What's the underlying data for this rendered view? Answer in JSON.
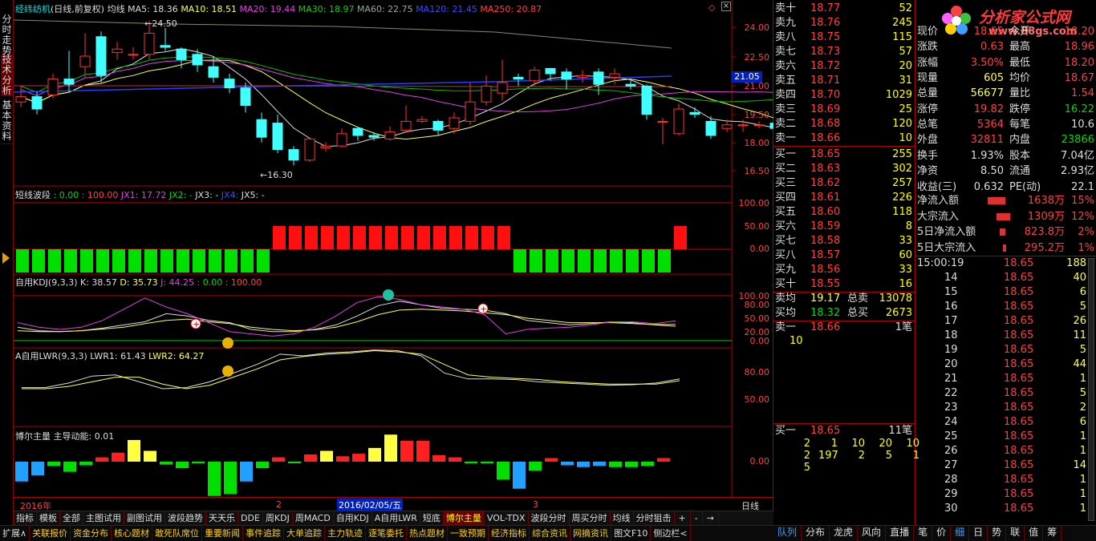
{
  "side_tabs": [
    "分时走势",
    "技术分析",
    "基本资料"
  ],
  "title": {
    "name": "经纬纺机",
    "mode": "(日线,前复权)",
    "ma_label": "均线",
    "ma5": "MA5: 18.36",
    "ma10": "MA10: 18.51",
    "ma20": "MA20: 19.44",
    "ma30": "MA30: 18.97",
    "ma60": "MA60: 22.75",
    "ma120": "MA120: 21.45",
    "ma250": "MA250: 20.87"
  },
  "price_axis": [
    "24.00",
    "22.50",
    "21.00",
    "19.50",
    "18.00",
    "16.50"
  ],
  "price_marker": "21.05",
  "annot_high": "24.50",
  "annot_low": "16.30",
  "wave": {
    "name": "短线波段",
    "v1": ": 0.00",
    "v2": ": 100.00",
    "jx1": "JX1: 17.72",
    "jx2": "JX2: -",
    "jx3": "JX3: -",
    "jx4": "JX4:",
    "jx5": "JX5: -",
    "axis": [
      "100.00",
      "50.00",
      "0.00"
    ]
  },
  "kdj": {
    "name": "自用KDJ(9,3,3)",
    "k": "K: 38.57",
    "d": "D: 35.73",
    "j": "J: 44.25",
    "v1": ": 0.00",
    "v2": ": 100.00",
    "axis": [
      "100.00",
      "80.00",
      "50.00",
      "20.00",
      "0.00"
    ]
  },
  "lwr": {
    "name": "A自用LWR(9,3,3)",
    "lwr1": "LWR1: 61.43",
    "lwr2": "LWR2: 64.27",
    "axis": [
      "80.00",
      "50.00"
    ]
  },
  "boer": {
    "name": "博尔主量",
    "sub": "主导动能: 0.01",
    "axis": [
      "0.00"
    ]
  },
  "date_axis": {
    "y2016": "2016年",
    "m2": "2",
    "sel": "2016/02/05/五",
    "m3": "3",
    "period": "日线"
  },
  "bottom_tabs": [
    "指标",
    "模板",
    "全部",
    "主图试用",
    "副图试用",
    "波段趋势",
    "天天乐",
    "DDE",
    "周KDJ",
    "周MACD",
    "自用KDJ",
    "A自用LWR",
    "短底",
    "博尔主量",
    "VOL-TDX",
    "波段分时",
    "周买分时",
    "均线",
    "分时狙击"
  ],
  "bottom_tab_controls": [
    "+",
    "-",
    "→"
  ],
  "bottom_bar": [
    "扩展∧",
    "关联报价",
    "资金分布",
    "核心题材",
    "敢死队席位",
    "重要新闻",
    "事件追踪",
    "大单追踪",
    "主力轨迹",
    "逐笔委托",
    "热点题材",
    "一致预期",
    "经济指标",
    "综合资讯",
    "网摘资讯",
    "图文F10",
    "侧边栏<"
  ],
  "right_tabs": [
    "队列",
    "分布",
    "龙虎",
    "风向",
    "直播",
    "笔",
    "价",
    "细",
    "日",
    "势",
    "联",
    "值",
    "筹"
  ],
  "sell": [
    {
      "l": "卖十",
      "p": "18.77",
      "v": "52"
    },
    {
      "l": "卖九",
      "p": "18.76",
      "v": "245"
    },
    {
      "l": "卖八",
      "p": "18.75",
      "v": "115"
    },
    {
      "l": "卖七",
      "p": "18.73",
      "v": "57"
    },
    {
      "l": "卖六",
      "p": "18.72",
      "v": "20"
    },
    {
      "l": "卖五",
      "p": "18.71",
      "v": "31"
    },
    {
      "l": "卖四",
      "p": "18.70",
      "v": "1029"
    },
    {
      "l": "卖三",
      "p": "18.69",
      "v": "25"
    },
    {
      "l": "卖二",
      "p": "18.68",
      "v": "120"
    },
    {
      "l": "卖一",
      "p": "18.66",
      "v": "10"
    }
  ],
  "buy": [
    {
      "l": "买一",
      "p": "18.65",
      "v": "255"
    },
    {
      "l": "买二",
      "p": "18.63",
      "v": "302"
    },
    {
      "l": "买三",
      "p": "18.62",
      "v": "257"
    },
    {
      "l": "买四",
      "p": "18.61",
      "v": "226"
    },
    {
      "l": "买五",
      "p": "18.60",
      "v": "118"
    },
    {
      "l": "买六",
      "p": "18.59",
      "v": "8"
    },
    {
      "l": "买七",
      "p": "18.58",
      "v": "33"
    },
    {
      "l": "买八",
      "p": "18.57",
      "v": "60"
    },
    {
      "l": "买九",
      "p": "18.56",
      "v": "33"
    },
    {
      "l": "买十",
      "p": "18.55",
      "v": "16"
    }
  ],
  "avg": {
    "sell_l": "卖均",
    "sell_p": "19.17",
    "sell_tl": "总卖",
    "sell_t": "13078",
    "buy_l": "买均",
    "buy_p": "18.32",
    "buy_tl": "总买",
    "buy_t": "2673"
  },
  "queue": {
    "s_l": "卖一",
    "s_p": "18.66",
    "s_n": "1笔",
    "s_v": "10",
    "b_l": "买一",
    "b_p": "18.65",
    "b_n": "11笔",
    "b_r1": [
      "2",
      "1",
      "10",
      "20",
      "10"
    ],
    "b_r2": [
      "2",
      "197",
      "2",
      "5",
      "1"
    ],
    "b_r3": [
      "5"
    ]
  },
  "quote": [
    {
      "a": "现价",
      "av": "18.65",
      "b": "今开",
      "bv": "18.20"
    },
    {
      "a": "涨跌",
      "av": "0.63",
      "b": "最高",
      "bv": "18.96"
    },
    {
      "a": "涨幅",
      "av": "3.50%",
      "b": "最低",
      "bv": "18.20"
    },
    {
      "a": "现量",
      "av": "605",
      "b": "均价",
      "bv": "18.67"
    },
    {
      "a": "总量",
      "av": "56677",
      "b": "量比",
      "bv": "1.54"
    },
    {
      "a": "涨停",
      "av": "19.82",
      "b": "跌停",
      "bv": "16.22"
    },
    {
      "a": "总笔",
      "av": "5364",
      "b": "每笔",
      "bv": "10.6"
    },
    {
      "a": "外盘",
      "av": "32811",
      "b": "内盘",
      "bv": "23866"
    },
    {
      "a": "换手",
      "av": "1.93%",
      "b": "股本",
      "bv": "7.04亿"
    },
    {
      "a": "净资",
      "av": "8.50",
      "b": "流通",
      "bv": "2.93亿"
    },
    {
      "a": "收益(三)",
      "av": "0.632",
      "b": "PE(动)",
      "bv": "22.1"
    }
  ],
  "flows": [
    {
      "l": "净流入额",
      "v": "1638万",
      "p": "15%"
    },
    {
      "l": "大宗流入",
      "v": "1309万",
      "p": "12%"
    },
    {
      "l": "5日净流入额",
      "v": "823.8万",
      "p": "2%"
    },
    {
      "l": "5日大宗流入",
      "v": "295.2万",
      "p": "1%"
    }
  ],
  "ticks": [
    {
      "t": "15:00:19",
      "p": "18.65",
      "v": "188"
    },
    {
      "t": "14",
      "p": "18.65",
      "v": "40"
    },
    {
      "t": "15",
      "p": "18.65",
      "v": "6"
    },
    {
      "t": "16",
      "p": "18.65",
      "v": "5"
    },
    {
      "t": "17",
      "p": "18.65",
      "v": "26"
    },
    {
      "t": "18",
      "p": "18.65",
      "v": "11"
    },
    {
      "t": "19",
      "p": "18.65",
      "v": "5"
    },
    {
      "t": "20",
      "p": "18.65",
      "v": "44"
    },
    {
      "t": "21",
      "p": "18.65",
      "v": "1"
    },
    {
      "t": "22",
      "p": "18.65",
      "v": "5"
    },
    {
      "t": "23",
      "p": "18.65",
      "v": "2"
    },
    {
      "t": "24",
      "p": "18.65",
      "v": "6"
    },
    {
      "t": "25",
      "p": "18.65",
      "v": "1"
    },
    {
      "t": "26",
      "p": "18.65",
      "v": "1"
    },
    {
      "t": "27",
      "p": "18.65",
      "v": "14"
    },
    {
      "t": "28",
      "p": "18.65",
      "v": "1"
    },
    {
      "t": "29",
      "p": "18.65",
      "v": "1"
    },
    {
      "t": "30",
      "p": "18.65",
      "v": "1"
    }
  ],
  "logo": {
    "text": "分析家公式网",
    "url": "www.88gs.com"
  },
  "colors": {
    "up": "#ff3030",
    "down": "#00ffff",
    "grid": "#a00000",
    "text": "#dddddd",
    "yellow": "#ffff50"
  },
  "chart_data": {
    "type": "candlestick",
    "candles": [
      [
        19.9,
        20.2,
        20.8,
        19.6
      ],
      [
        20.2,
        19.5,
        20.5,
        19.2
      ],
      [
        20.3,
        21.2,
        21.5,
        20.1
      ],
      [
        21.2,
        20.9,
        22.8,
        20.5
      ],
      [
        21.9,
        22.5,
        23.8,
        21.3
      ],
      [
        23.6,
        21.4,
        23.9,
        21.0
      ],
      [
        22.7,
        22.9,
        23.3,
        22.3
      ],
      [
        22.6,
        22.6,
        23.0,
        22.3
      ],
      [
        22.6,
        23.8,
        24.5,
        22.3
      ],
      [
        23.1,
        23.0,
        24.1,
        22.8
      ],
      [
        22.9,
        22.3,
        23.0,
        21.8
      ],
      [
        22.6,
        22.0,
        22.9,
        21.6
      ],
      [
        21.9,
        21.3,
        22.5,
        21.0
      ],
      [
        21.2,
        20.7,
        21.5,
        20.4
      ],
      [
        20.7,
        19.7,
        21.0,
        19.3
      ],
      [
        18.9,
        17.9,
        19.3,
        17.6
      ],
      [
        18.7,
        17.2,
        19.2,
        17.0
      ],
      [
        17.2,
        16.6,
        17.4,
        16.3
      ],
      [
        16.6,
        17.8,
        17.9,
        16.5
      ],
      [
        17.3,
        17.4,
        17.6,
        17.1
      ],
      [
        17.4,
        18.1,
        18.4,
        17.3
      ],
      [
        18.4,
        18.0,
        18.5,
        17.7
      ],
      [
        18.0,
        17.9,
        18.2,
        17.7
      ],
      [
        17.8,
        18.2,
        18.5,
        17.7
      ],
      [
        18.3,
        18.8,
        19.7,
        18.2
      ],
      [
        18.8,
        18.9,
        19.1,
        18.7
      ],
      [
        18.8,
        18.3,
        18.9,
        18.0
      ],
      [
        18.4,
        19.0,
        19.3,
        18.1
      ],
      [
        18.8,
        19.9,
        21.0,
        18.6
      ],
      [
        19.9,
        20.8,
        21.4,
        19.7
      ],
      [
        20.4,
        21.0,
        22.3,
        20.0
      ],
      [
        21.3,
        21.2,
        21.5,
        20.8
      ],
      [
        21.1,
        21.7,
        21.9,
        20.8
      ],
      [
        21.8,
        21.5,
        21.8,
        21.1
      ],
      [
        21.6,
        21.2,
        21.8,
        20.6
      ],
      [
        21.3,
        21.4,
        21.7,
        21.0
      ],
      [
        21.6,
        20.9,
        21.8,
        20.3
      ],
      [
        21.3,
        21.5,
        21.8,
        20.9
      ],
      [
        20.9,
        20.8,
        21.2,
        20.6
      ],
      [
        20.8,
        19.2,
        20.9,
        18.9
      ],
      [
        18.8,
        18.8,
        19.0,
        17.5
      ],
      [
        18.1,
        19.5,
        19.8,
        18.0
      ],
      [
        19.3,
        19.2,
        19.6,
        19.0
      ],
      [
        18.8,
        18.0,
        19.1,
        17.8
      ],
      [
        18.4,
        18.6,
        18.9,
        18.2
      ],
      [
        18.6,
        18.6,
        18.9,
        18.2
      ],
      [
        18.6,
        18.6,
        18.8,
        18.4
      ],
      [
        18.7,
        18.4,
        18.9,
        18.3
      ],
      [
        18.6,
        18.1,
        18.7,
        18.0
      ],
      [
        18.2,
        18.0,
        18.4,
        17.8
      ],
      [
        18.1,
        18.3,
        18.5,
        18.0
      ],
      [
        18.2,
        18.6,
        18.9,
        18.0
      ]
    ],
    "ylim": [
      16.0,
      25.0
    ],
    "wave_signal": [
      0,
      0,
      0,
      0,
      0,
      0,
      0,
      0,
      0,
      0,
      0,
      0,
      0,
      0,
      0,
      0,
      1,
      1,
      1,
      1,
      1,
      1,
      1,
      1,
      1,
      1,
      1,
      1,
      1,
      1,
      1,
      0,
      0,
      0,
      0,
      0,
      0,
      0,
      0,
      0,
      0,
      1
    ],
    "boer": [
      -55,
      -38,
      -12,
      -28,
      -10,
      12,
      25,
      60,
      30,
      -8,
      -18,
      -5,
      -95,
      -90,
      -55,
      -18,
      12,
      -4,
      20,
      30,
      15,
      22,
      38,
      75,
      58,
      58,
      18,
      12,
      -5,
      -5,
      -50,
      -75,
      -25,
      10,
      -10,
      -15,
      -12,
      -15,
      -15,
      -12,
      10
    ],
    "kdj_k": [
      30,
      22,
      20,
      22,
      28,
      35,
      42,
      60,
      55,
      45,
      40,
      25,
      20,
      20,
      25,
      35,
      55,
      78,
      88,
      80,
      72,
      70,
      68,
      60,
      45,
      40,
      35,
      38,
      42,
      40,
      35,
      32
    ],
    "kdj_d": [
      22,
      20,
      20,
      22,
      26,
      30,
      38,
      45,
      48,
      42,
      38,
      30,
      25,
      22,
      24,
      30,
      42,
      58,
      68,
      70,
      68,
      66,
      62,
      58,
      50,
      45,
      40,
      40,
      40,
      38,
      36,
      36
    ],
    "kdj_j": [
      40,
      30,
      25,
      30,
      45,
      70,
      95,
      75,
      60,
      40,
      20,
      15,
      10,
      15,
      30,
      55,
      85,
      98,
      92,
      80,
      75,
      70,
      58,
      15,
      25,
      28,
      30,
      35,
      42,
      42,
      38,
      44
    ],
    "lwr1": [
      80,
      80,
      72,
      60,
      58,
      70,
      82,
      80,
      70,
      55,
      40,
      22,
      25,
      20,
      18,
      15,
      16,
      25,
      55,
      65,
      65,
      66,
      70,
      72,
      74,
      76,
      75,
      72,
      65
    ],
    "lwr2": [
      82,
      82,
      78,
      70,
      62,
      62,
      74,
      82,
      76,
      62,
      48,
      32,
      26,
      22,
      20,
      16,
      18,
      22,
      40,
      58,
      62,
      64,
      66,
      70,
      72,
      74,
      74,
      74,
      68
    ]
  }
}
